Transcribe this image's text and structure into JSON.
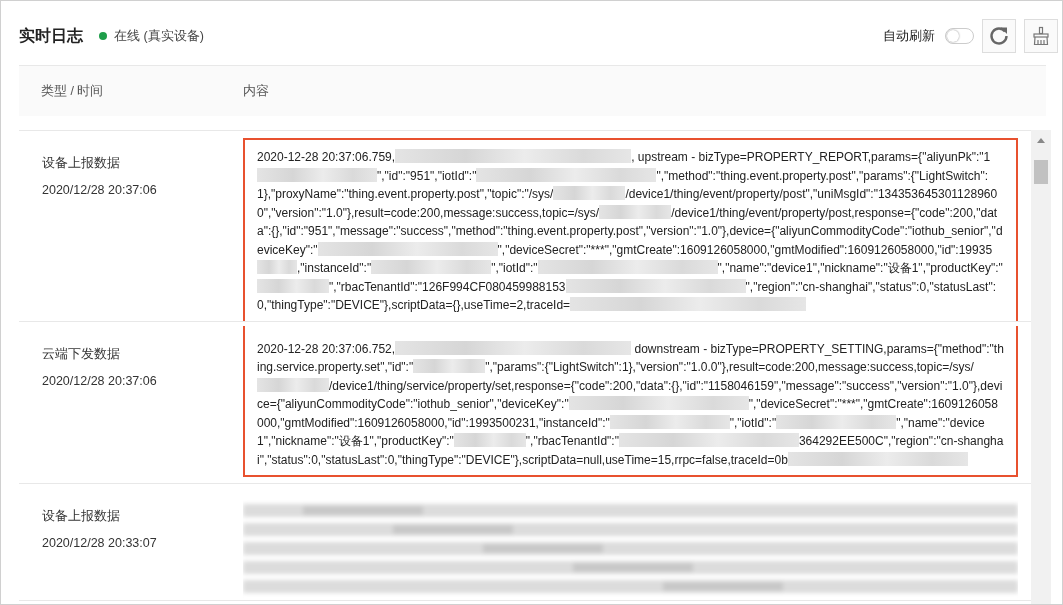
{
  "header": {
    "title": "实时日志",
    "status": {
      "text": "在线 (真实设备)",
      "online": true
    },
    "auto_refresh": {
      "label": "自动刷新",
      "on": false
    }
  },
  "table": {
    "columns": [
      "类型 / 时间",
      "内容"
    ],
    "rows": [
      {
        "type": "设备上报数据",
        "time": "2020/12/28 20:37:06",
        "highlighted": true,
        "content": [
          {
            "kind": "text",
            "text": "2020-12-28 20:37:06.759,"
          },
          {
            "kind": "blurwidest"
          },
          {
            "kind": "text",
            "text": ", upstream - bizType=PROPERTY_REPORT,params={\"aliyunPk\":\"1"
          },
          {
            "kind": "blurlong"
          },
          {
            "kind": "text",
            "text": "\",\"id\":\"951\",\"iotId\":\""
          },
          {
            "kind": "blurwide"
          },
          {
            "kind": "text",
            "text": "\",\"method\":\"thing.event.property.post\",\"params\":{\"LightSwitch\":1},\"proxyName\":\"thing.event.property.post\",\"topic\":\"/sys/"
          },
          {
            "kind": "blurmedium"
          },
          {
            "kind": "text",
            "text": "/device1/thing/event/property/post\",\"uniMsgId\":\"1343536453011289600\",\"version\":\"1.0\"},result=code:200,message:success,topic=/sys/"
          },
          {
            "kind": "blurmedium"
          },
          {
            "kind": "text",
            "text": "/device1/thing/event/property/post,response={\"code\":200,\"data\":{},\"id\":\"951\",\"message\":\"success\",\"method\":\"thing.event.property.post\",\"version\":\"1.0\"},device={\"aliyunCommodityCode\":\"iothub_senior\",\"deviceKey\":\""
          },
          {
            "kind": "blurwide"
          },
          {
            "kind": "text",
            "text": "\",\"deviceSecret\":\"***\",\"gmtCreate\":1609126058000,\"gmtModified\":1609126058000,\"id\":19935"
          },
          {
            "kind": "blurshort"
          },
          {
            "kind": "text",
            "text": ",\"instanceId\":\""
          },
          {
            "kind": "blurlong"
          },
          {
            "kind": "text",
            "text": "\",\"iotId\":\""
          },
          {
            "kind": "blurwide"
          },
          {
            "kind": "text",
            "text": "\",\"name\":\"device1\",\"nickname\":\"设备1\",\"productKey\":\""
          },
          {
            "kind": "blurmedium"
          },
          {
            "kind": "text",
            "text": "\",\"rbacTenantId\":\"126F994CF080459988153"
          },
          {
            "kind": "blurwide"
          },
          {
            "kind": "text",
            "text": "\",\"region\":\"cn-shanghai\",\"status\":0,\"statusLast\":0,\"thingType\":\"DEVICE\"},scriptData={},useTime=2,traceId="
          },
          {
            "kind": "blurwidest"
          }
        ]
      },
      {
        "type": "云端下发数据",
        "time": "2020/12/28 20:37:06",
        "highlighted": true,
        "content": [
          {
            "kind": "text",
            "text": "2020-12-28 20:37:06.752,"
          },
          {
            "kind": "blurwidest"
          },
          {
            "kind": "text",
            "text": " downstream - bizType=PROPERTY_SETTING,params={\"method\":\"thing.service.property.set\",\"id\":\""
          },
          {
            "kind": "blurmedium"
          },
          {
            "kind": "text",
            "text": "\",\"params\":{\"LightSwitch\":1},\"version\":\"1.0.0\"},result=code:200,message:success,topic=/sys/"
          },
          {
            "kind": "blurmedium"
          },
          {
            "kind": "text",
            "text": "/device1/thing/service/property/set,response={\"code\":200,\"data\":{},\"id\":\"1158046159\",\"message\":\"success\",\"version\":\"1.0\"},device={\"aliyunCommodityCode\":\"iothub_senior\",\"deviceKey\":\""
          },
          {
            "kind": "blurwide"
          },
          {
            "kind": "text",
            "text": "\",\"deviceSecret\":\"***\",\"gmtCreate\":1609126058000,\"gmtModified\":1609126058000,\"id\":1993500231,\"instanceId\":\""
          },
          {
            "kind": "blurlong"
          },
          {
            "kind": "text",
            "text": "\",\"iotId\":\""
          },
          {
            "kind": "blurlong"
          },
          {
            "kind": "text",
            "text": "\",\"name\":\"device1\",\"nickname\":\"设备1\",\"productKey\":\""
          },
          {
            "kind": "blurmedium"
          },
          {
            "kind": "text",
            "text": "\",\"rbacTenantId\":\""
          },
          {
            "kind": "blurwide"
          },
          {
            "kind": "text",
            "text": "364292EE500C\",\"region\":\"cn-shanghai\",\"status\":0,\"statusLast\":0,\"thingType\":\"DEVICE\"},scriptData=null,useTime=15,rrpc=false,traceId=0b"
          },
          {
            "kind": "blurwide"
          }
        ]
      },
      {
        "type": "设备上报数据",
        "time": "2020/12/28 20:33:07",
        "highlighted": false,
        "content": [
          {
            "kind": "redacted-block"
          }
        ]
      }
    ]
  }
}
